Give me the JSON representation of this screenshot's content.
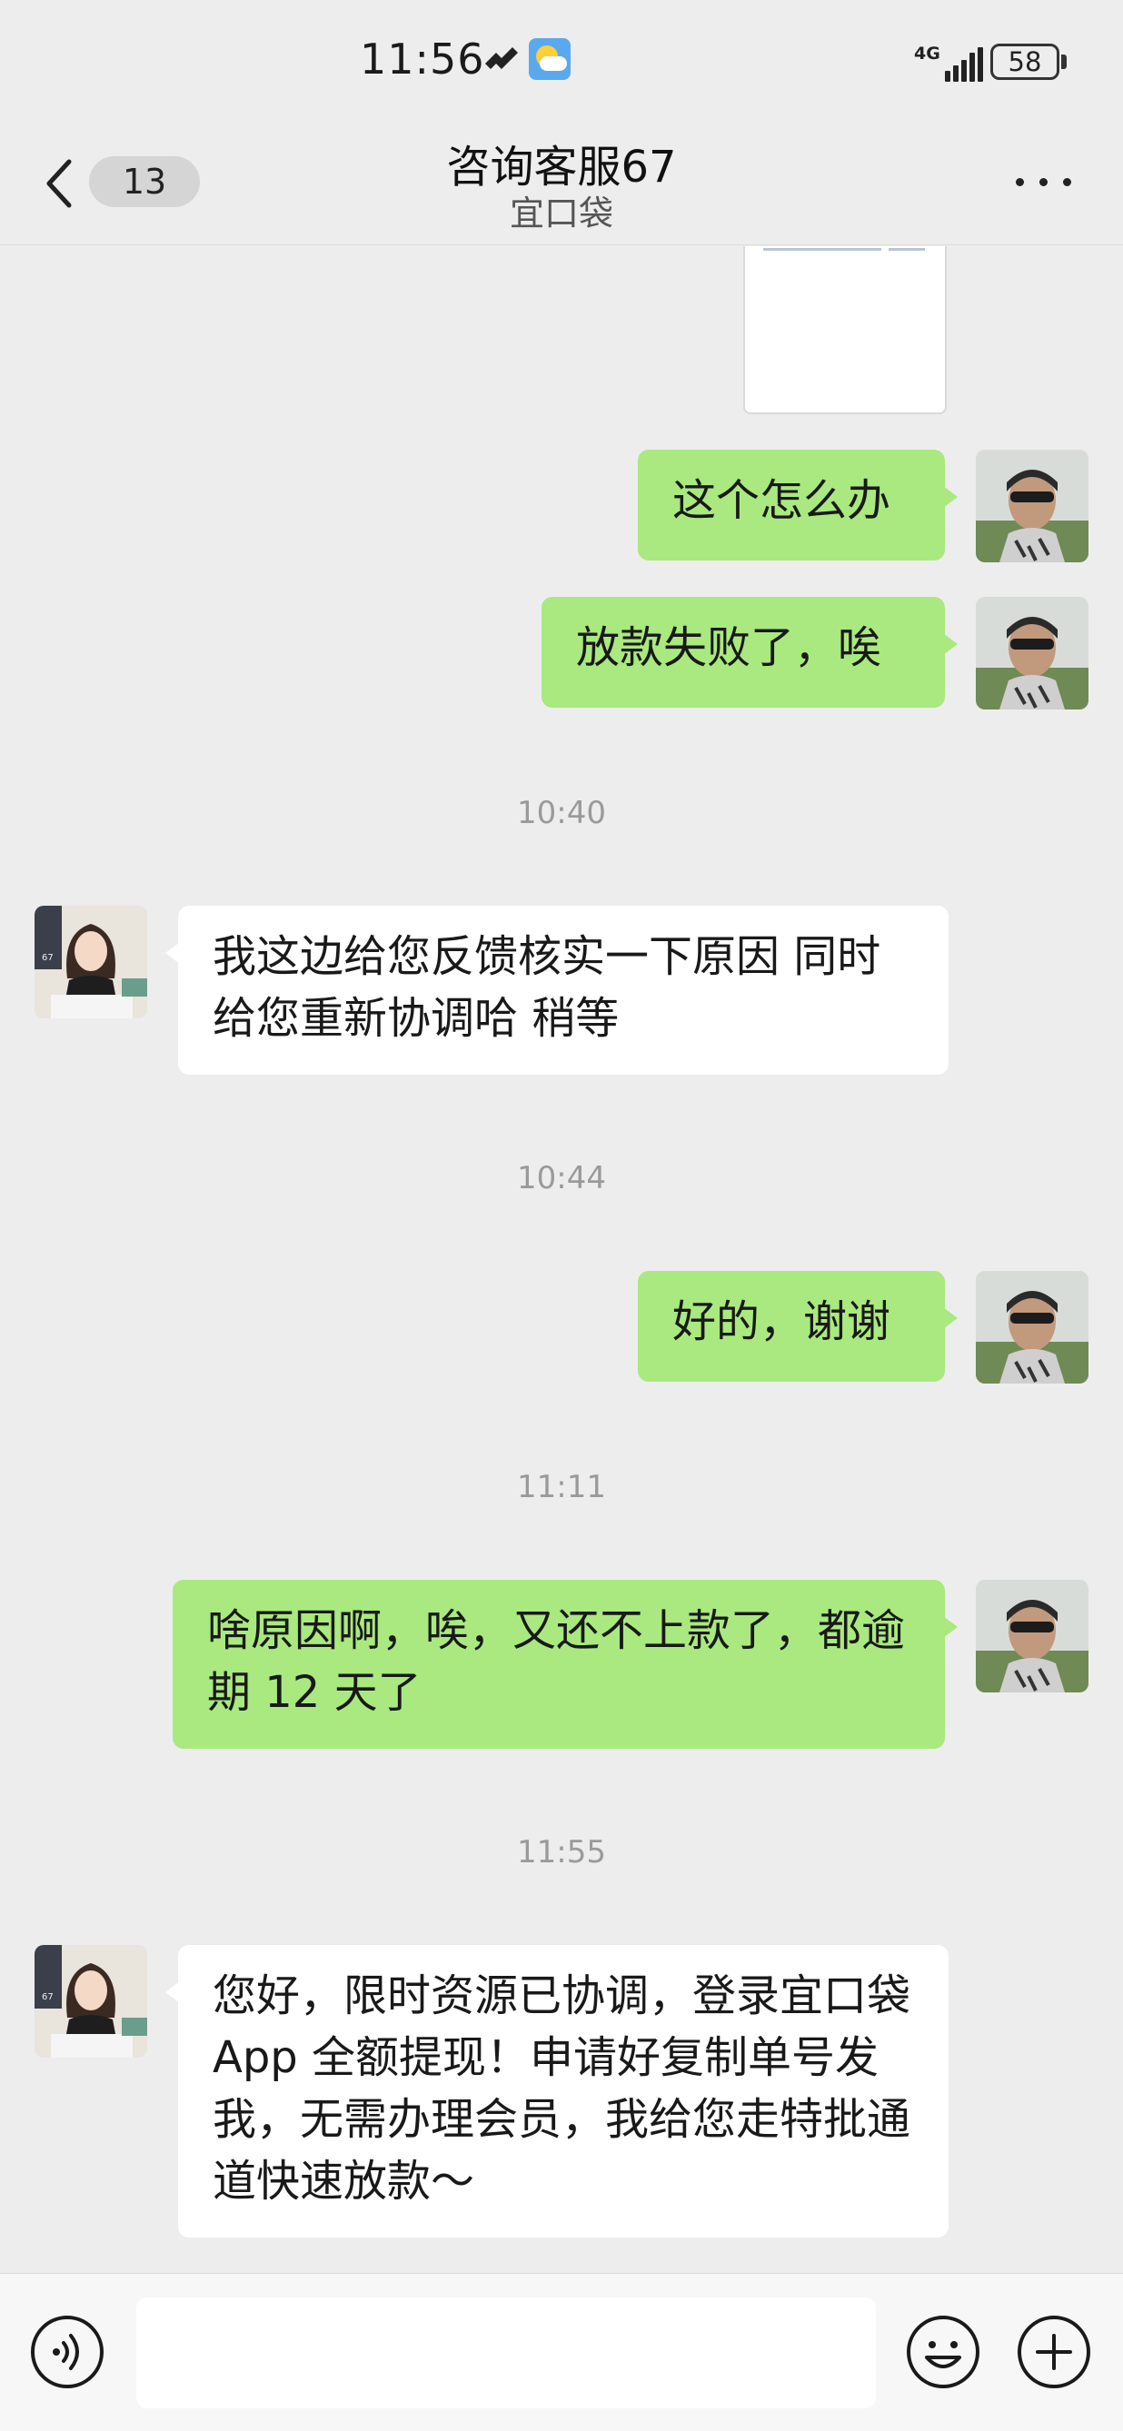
{
  "status_bar": {
    "time": "11:56",
    "network": "4G",
    "battery": "58"
  },
  "nav": {
    "unread_count": "13",
    "title": "咨询客服67",
    "subtitle": "宜口袋"
  },
  "messages": [
    {
      "id": "m1",
      "sender": "self",
      "text": "这个怎么办"
    },
    {
      "id": "m2",
      "sender": "self",
      "text": "放款失败了，唉"
    },
    {
      "id": "t1",
      "type": "timestamp",
      "text": "10:40"
    },
    {
      "id": "m3",
      "sender": "other",
      "text": "我这边给您反馈核实一下原因 同时给您重新协调哈 稍等"
    },
    {
      "id": "t2",
      "type": "timestamp",
      "text": "10:44"
    },
    {
      "id": "m4",
      "sender": "self",
      "text": "好的，谢谢"
    },
    {
      "id": "t3",
      "type": "timestamp",
      "text": "11:11"
    },
    {
      "id": "m5",
      "sender": "self",
      "text": "啥原因啊，唉，又还不上款了，都逾期 12 天了"
    },
    {
      "id": "t4",
      "type": "timestamp",
      "text": "11:55"
    },
    {
      "id": "m6",
      "sender": "other",
      "text": "您好，限时资源已协调，登录宜口袋 App 全额提现！申请好复制单号发我，无需办理会员，我给您走特批通道快速放款～"
    }
  ],
  "avatars": {
    "other_badge": "67"
  },
  "input_bar": {
    "value": "",
    "icons": [
      "voice-icon",
      "emoji-icon",
      "plus-icon"
    ]
  },
  "colors": {
    "self_bubble": "#a9e97f",
    "other_bubble": "#ffffff",
    "background": "#ededed"
  }
}
